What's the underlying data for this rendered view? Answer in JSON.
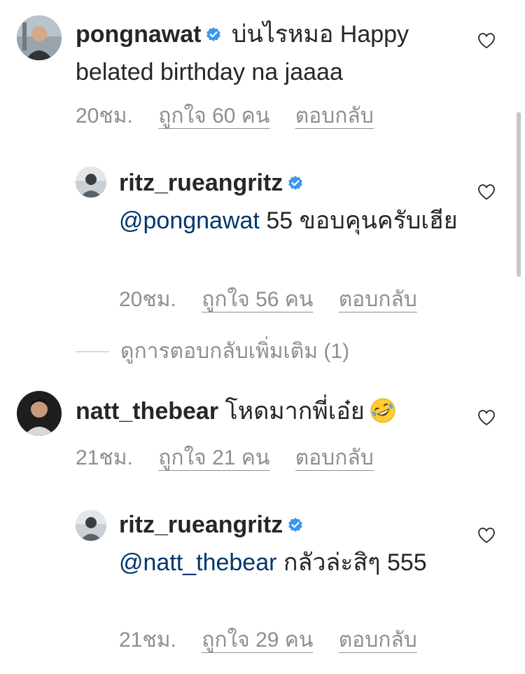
{
  "comments": [
    {
      "username": "pongnawat",
      "verified": true,
      "text": "บ่นไรหมอ Happy belated birthday na jaaaa",
      "time": "20ชม.",
      "likes": "ถูกใจ 60 คน",
      "reply": "ตอบกลับ"
    },
    {
      "username": "ritz_rueangritz",
      "verified": true,
      "mention": "@pongnawat",
      "text": "55 ขอบคุนครับเฮีย",
      "time": "20ชม.",
      "likes": "ถูกใจ 56 คน",
      "reply": "ตอบกลับ"
    },
    {
      "username": "natt_thebear",
      "verified": false,
      "text": "โหดมากพี่เอ๋ย",
      "emoji": "rolling-laughing-emoji",
      "time": "21ชม.",
      "likes": "ถูกใจ 21 คน",
      "reply": "ตอบกลับ"
    },
    {
      "username": "ritz_rueangritz",
      "verified": true,
      "mention": "@natt_thebear",
      "text": "กลัวล่ะสิๆ 555",
      "time": "21ชม.",
      "likes": "ถูกใจ 29 คน",
      "reply": "ตอบกลับ"
    }
  ],
  "more_replies": "ดูการตอบกลับเพิ่มเติม (1)",
  "colors": {
    "text": "#262626",
    "secondary": "#8e8e8e",
    "mention": "#00376b",
    "verified": "#3897f0"
  }
}
